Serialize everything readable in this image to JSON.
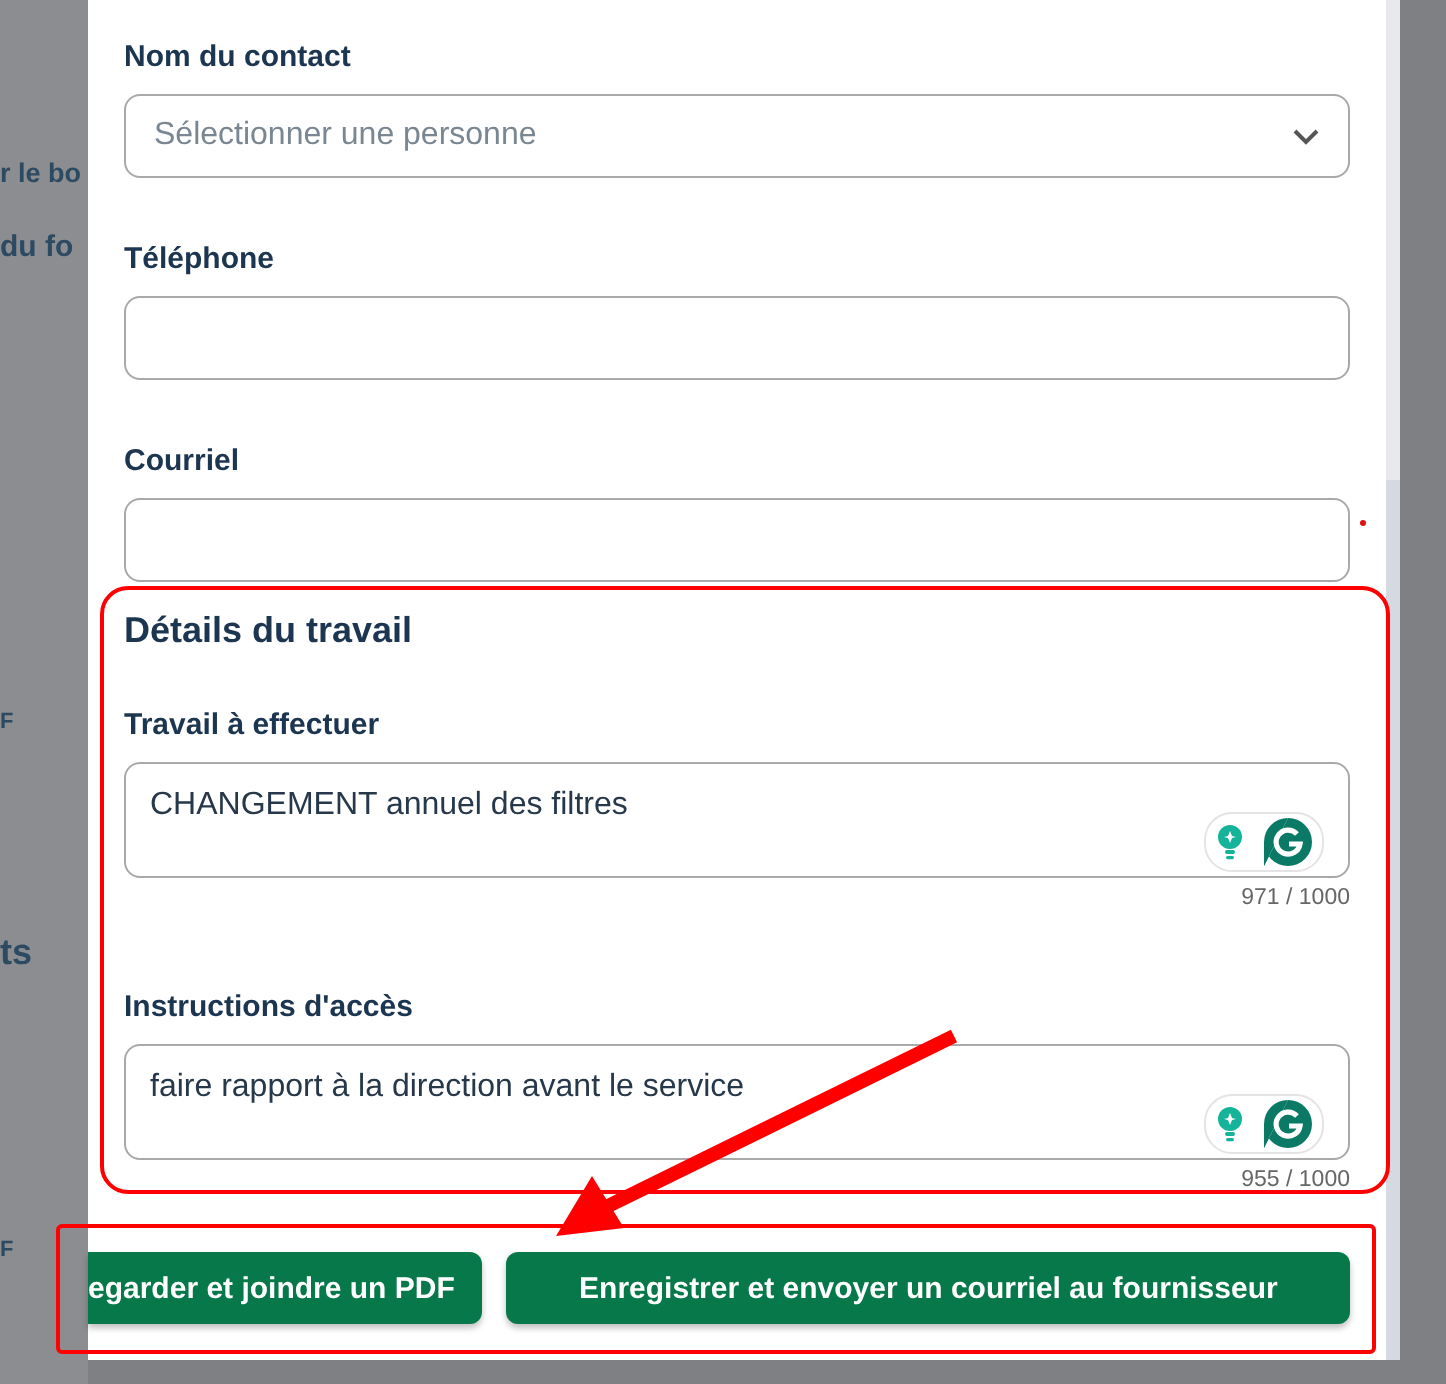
{
  "background": {
    "texts": [
      "r le bo",
      "du fo",
      "F",
      "ts",
      "F"
    ]
  },
  "contact": {
    "name_label": "Nom du contact",
    "name_placeholder": "Sélectionner une personne",
    "phone_label": "Téléphone",
    "email_label": "Courriel",
    "email_required": true
  },
  "work_details": {
    "title": "Détails du travail",
    "fields": [
      {
        "label": "Travail à effectuer",
        "value": "CHANGEMENT annuel des filtres",
        "counter": "971 / 1000"
      },
      {
        "label": "Instructions d'accès",
        "value": "faire rapport à la direction avant le service",
        "counter": "955 / 1000"
      }
    ]
  },
  "buttons": [
    {
      "label": "egarder et joindre un PDF"
    },
    {
      "label": "Enregistrer et envoyer un courriel au fournisseur"
    }
  ],
  "annotations": [
    {
      "kind": "frame"
    },
    {
      "kind": "frame"
    },
    {
      "kind": "arrow"
    }
  ]
}
